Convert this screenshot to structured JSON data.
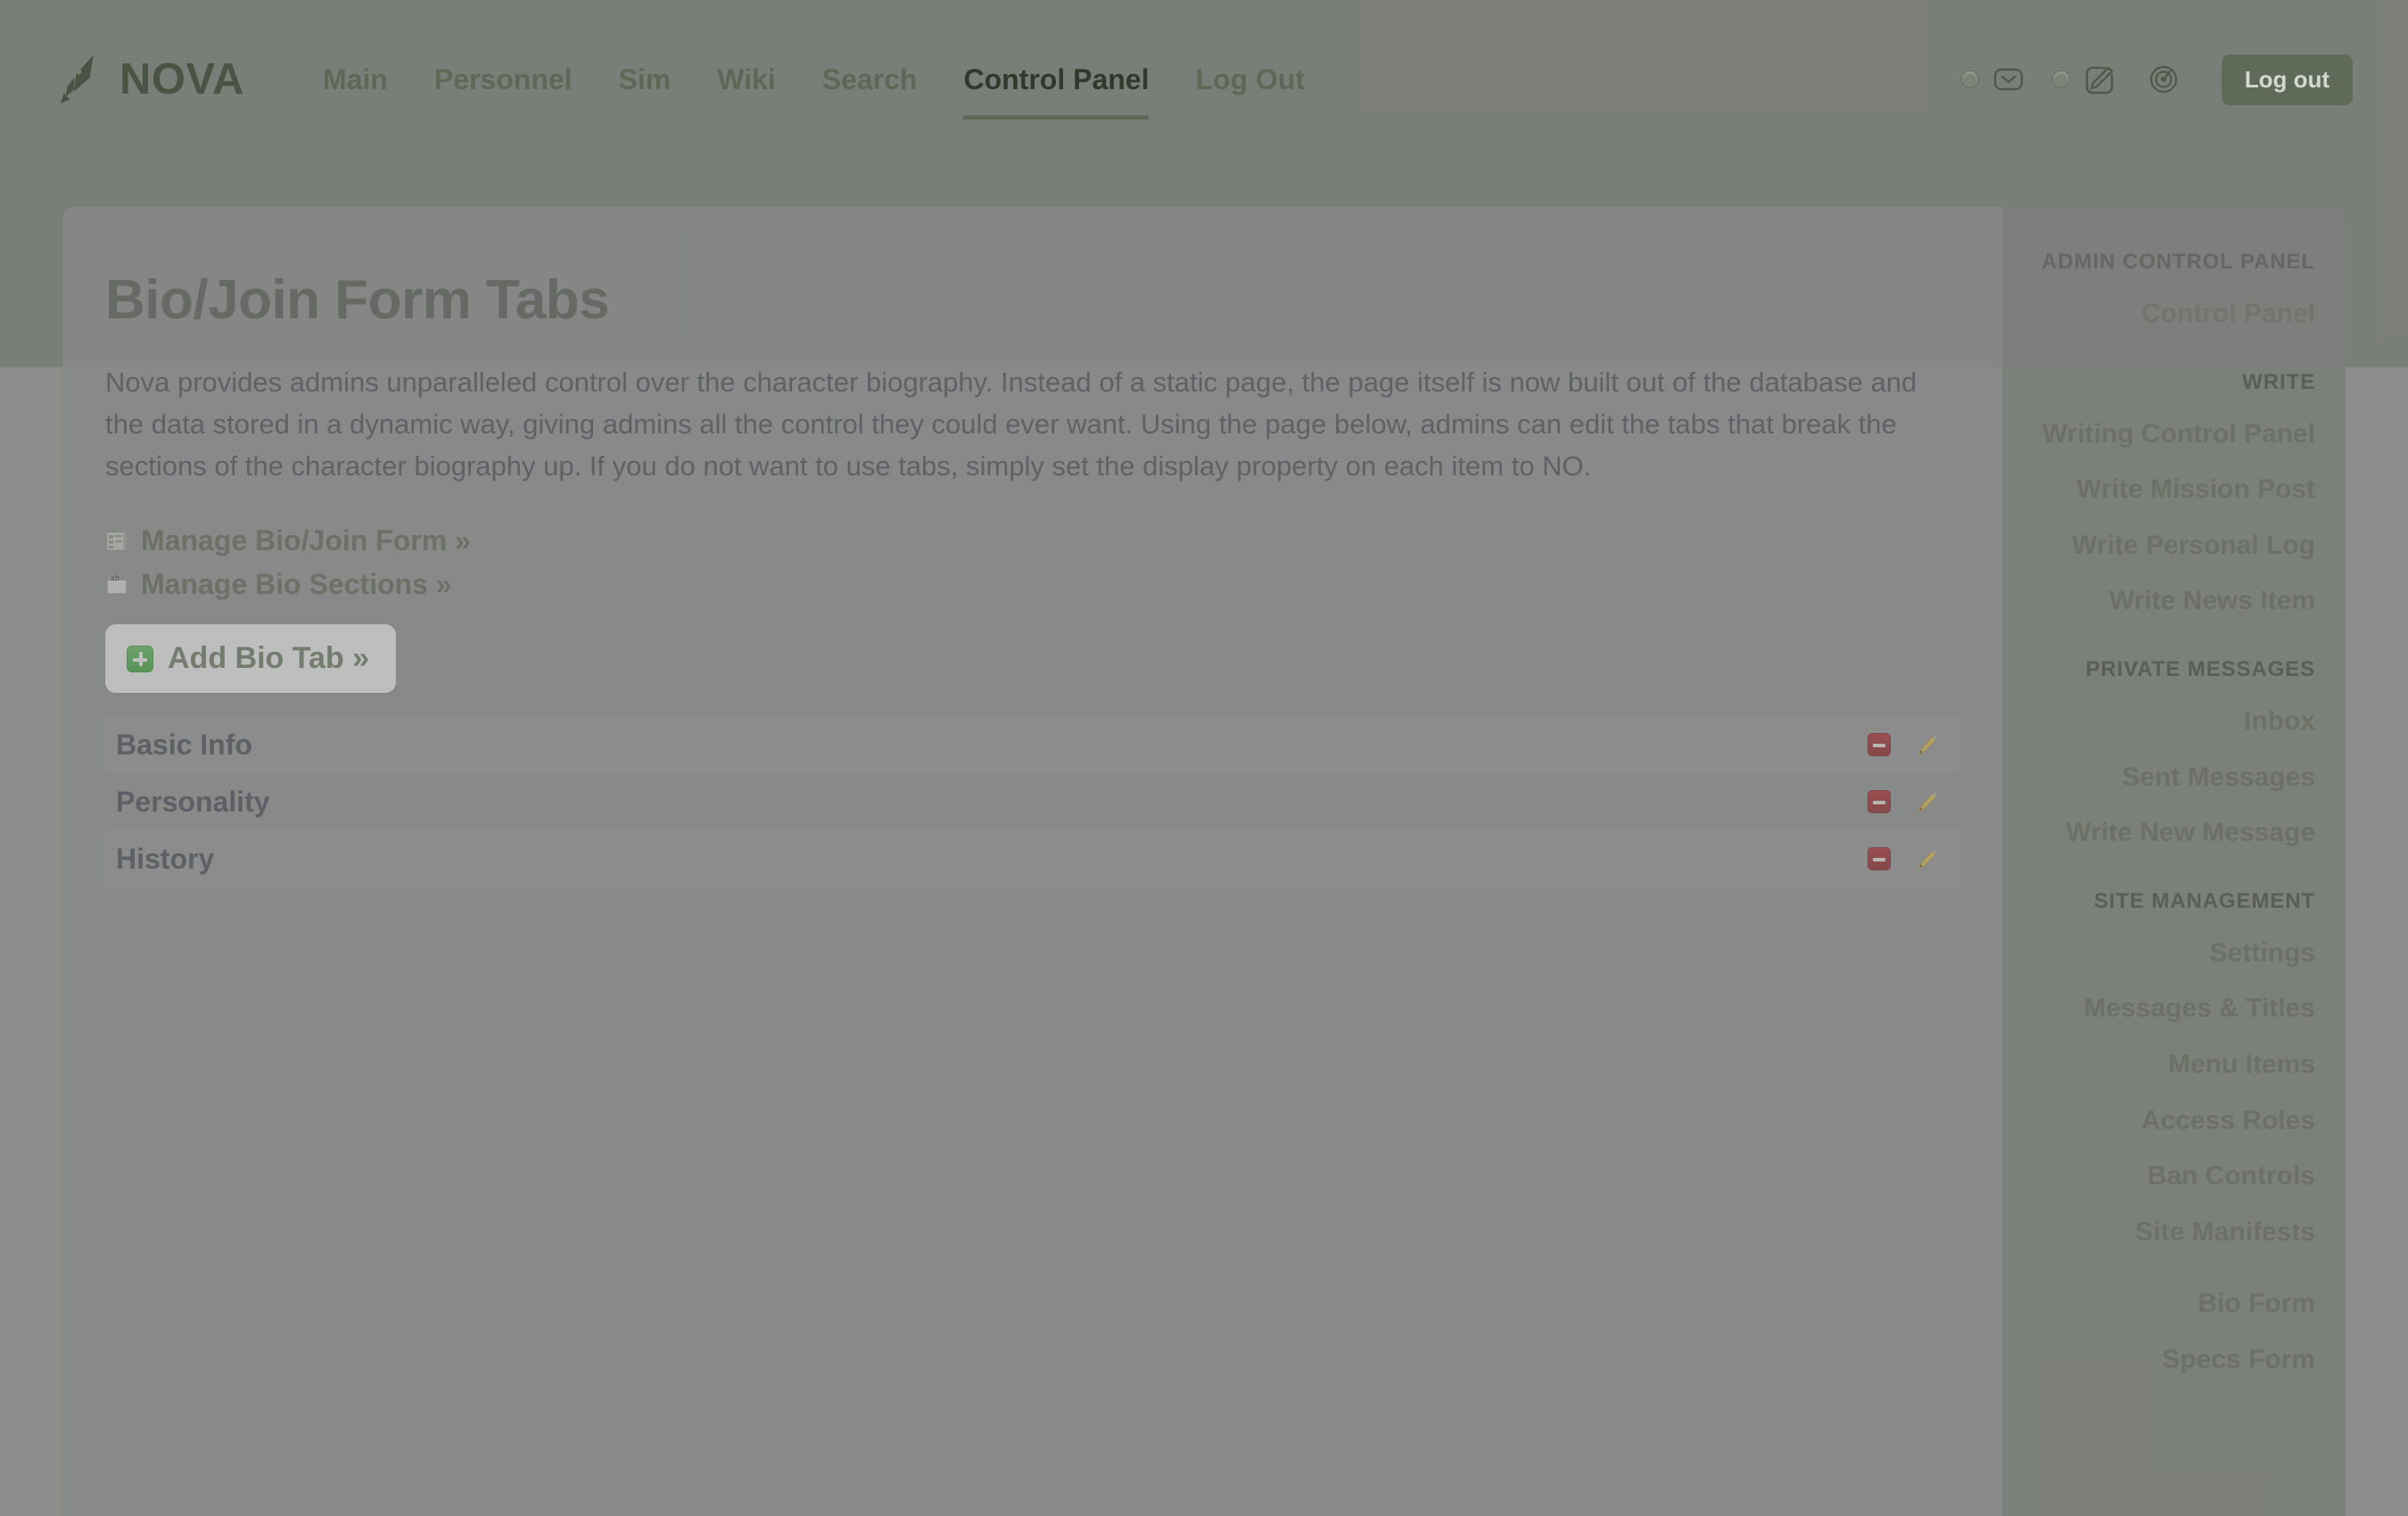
{
  "brand": {
    "name": "NOVA",
    "mark_icon": "pen-nib-icon"
  },
  "nav": {
    "items": [
      {
        "label": "Main",
        "active": false
      },
      {
        "label": "Personnel",
        "active": false
      },
      {
        "label": "Sim",
        "active": false
      },
      {
        "label": "Wiki",
        "active": false
      },
      {
        "label": "Search",
        "active": false
      },
      {
        "label": "Control Panel",
        "active": true
      },
      {
        "label": "Log Out",
        "active": false
      }
    ]
  },
  "topbar_right": {
    "mail_icon": "envelope-icon",
    "write_icon": "pencil-square-icon",
    "gauge_icon": "speedometer-icon",
    "logout_label": "Log out"
  },
  "main": {
    "title": "Bio/Join Form Tabs",
    "intro": "Nova provides admins unparalleled control over the character biography. Instead of a static page, the page itself is now built out of the database and the data stored in a dynamic way, giving admins all the control they could ever want. Using the page below, admins can edit the tabs that break the sections of the character biography up. If you do not want to use tabs, simply set the display property on each item to NO.",
    "links": [
      {
        "label": "Manage Bio/Join Form »",
        "icon": "form-grid-icon"
      },
      {
        "label": "Manage Bio Sections »",
        "icon": "ab-tab-icon"
      }
    ],
    "add_button": {
      "label": "Add Bio Tab »",
      "icon": "green-plus-icon"
    },
    "tabs": [
      {
        "name": "Basic Info",
        "delete_icon": "minus-delete-icon",
        "edit_icon": "pencil-edit-icon"
      },
      {
        "name": "Personality",
        "delete_icon": "minus-delete-icon",
        "edit_icon": "pencil-edit-icon"
      },
      {
        "name": "History",
        "delete_icon": "minus-delete-icon",
        "edit_icon": "pencil-edit-icon"
      }
    ]
  },
  "sidebar": {
    "groups": [
      {
        "heading": "ADMIN CONTROL PANEL",
        "links": [
          {
            "label": "Control Panel"
          }
        ]
      },
      {
        "heading": "WRITE",
        "links": [
          {
            "label": "Writing Control Panel"
          },
          {
            "label": "Write Mission Post"
          },
          {
            "label": "Write Personal Log"
          },
          {
            "label": "Write News Item"
          }
        ]
      },
      {
        "heading": "PRIVATE MESSAGES",
        "links": [
          {
            "label": "Inbox"
          },
          {
            "label": "Sent Messages"
          },
          {
            "label": "Write New Message"
          }
        ]
      },
      {
        "heading": "SITE MANAGEMENT",
        "links": [
          {
            "label": "Settings"
          },
          {
            "label": "Messages & Titles"
          },
          {
            "label": "Menu Items"
          },
          {
            "label": "Access Roles"
          },
          {
            "label": "Ban Controls"
          },
          {
            "label": "Site Manifests"
          }
        ]
      },
      {
        "heading": "",
        "links": [
          {
            "label": "Bio Form"
          },
          {
            "label": "Specs Form"
          }
        ]
      }
    ]
  },
  "colors": {
    "header_green": "#757f6f",
    "card_gray": "#939694",
    "sidebar_green": "#7b8276",
    "title_dark_green": "#3a4435",
    "link_green": "#59654f",
    "delete_red": "#b62020",
    "add_green": "#2fa82c"
  }
}
